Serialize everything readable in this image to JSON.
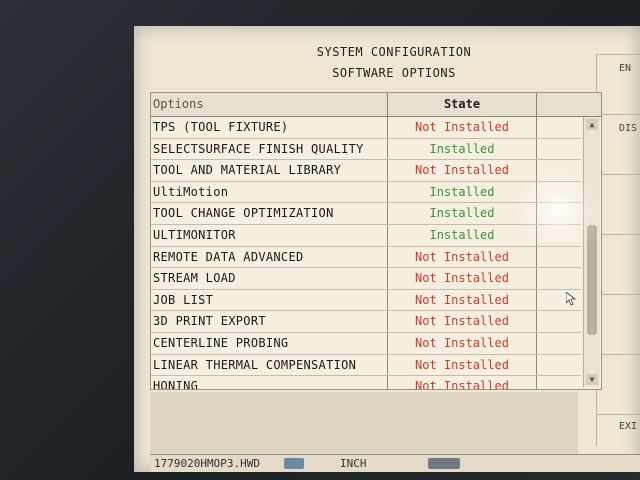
{
  "header": {
    "line1": "SYSTEM CONFIGURATION",
    "line2": "SOFTWARE OPTIONS"
  },
  "right_panel": {
    "top_label": "EN",
    "dis_label": "DIS",
    "exit_label": "EXI"
  },
  "table": {
    "columns": [
      "Options",
      "State"
    ],
    "rows": [
      {
        "option": "TPS (TOOL FIXTURE)",
        "state": "Not Installed"
      },
      {
        "option": "SELECTSURFACE FINISH QUALITY",
        "state": "Installed"
      },
      {
        "option": "TOOL AND MATERIAL LIBRARY",
        "state": "Not Installed"
      },
      {
        "option": "UltiMotion",
        "state": "Installed"
      },
      {
        "option": "TOOL CHANGE OPTIMIZATION",
        "state": "Installed"
      },
      {
        "option": "ULTIMONITOR",
        "state": "Installed"
      },
      {
        "option": "REMOTE DATA ADVANCED",
        "state": "Not Installed"
      },
      {
        "option": "STREAM LOAD",
        "state": "Not Installed"
      },
      {
        "option": "JOB LIST",
        "state": "Not Installed"
      },
      {
        "option": "3D PRINT EXPORT",
        "state": "Not Installed"
      },
      {
        "option": "CENTERLINE PROBING",
        "state": "Not Installed"
      },
      {
        "option": "LINEAR THERMAL COMPENSATION",
        "state": "Not Installed"
      },
      {
        "option": "HONING",
        "state": "Not Installed"
      }
    ]
  },
  "statusbar": {
    "filename": "1779020HMOP3.HWD",
    "units": "INCH"
  },
  "colors": {
    "installed": "#2e9a35",
    "not_installed": "#d23a2a",
    "screen_bg": "#efe6d4"
  },
  "icons": {
    "keyboard": "keyboard-icon",
    "scroll_up": "scroll-up-icon",
    "scroll_down": "scroll-down-icon",
    "pointer": "mouse-pointer-icon"
  }
}
